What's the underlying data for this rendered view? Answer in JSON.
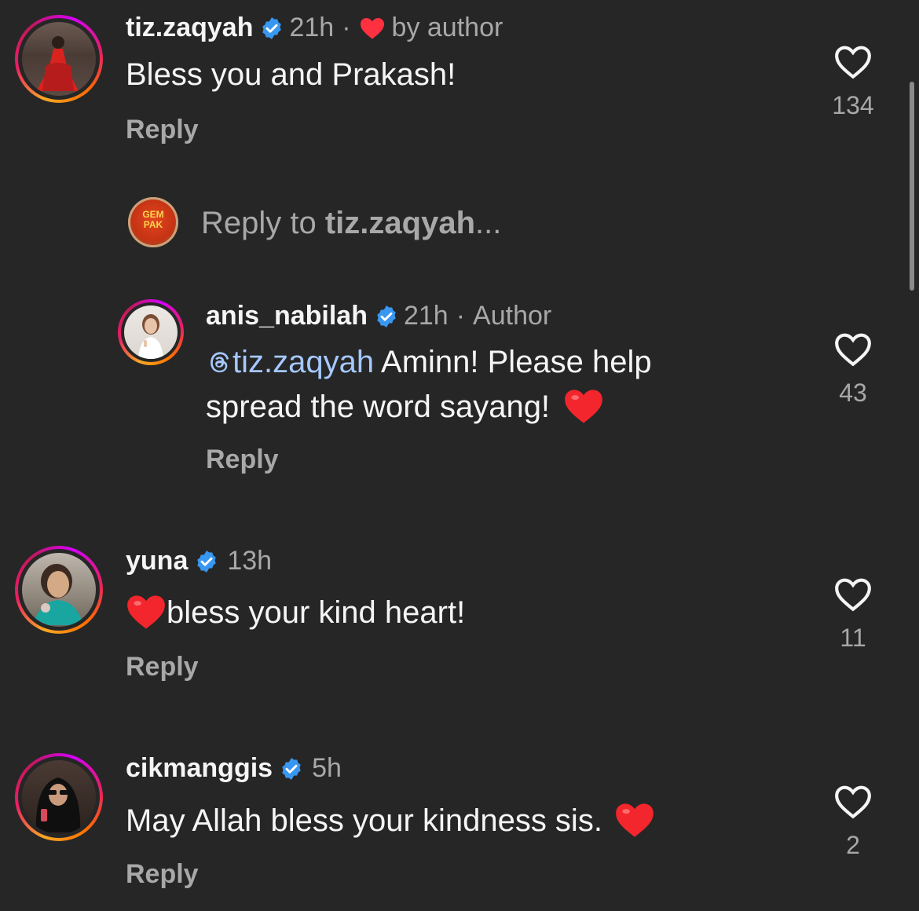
{
  "comments": [
    {
      "username": "tiz.zaqyah",
      "time": "21h",
      "liked_by_author": "by author",
      "text": "Bless you and Prakash!",
      "reply_label": "Reply",
      "likes": "134"
    },
    {
      "username": "yuna",
      "time": "13h",
      "text": "bless your kind heart!",
      "reply_label": "Reply",
      "likes": "11"
    },
    {
      "username": "cikmanggis",
      "time": "5h",
      "text": "May Allah bless your kindness sis.",
      "reply_label": "Reply",
      "likes": "2"
    }
  ],
  "reply_composer": {
    "avatar_text": "GEM PAK",
    "prefix": "Reply to ",
    "target": "tiz.zaqyah",
    "suffix": "..."
  },
  "reply": {
    "username": "anis_nabilah",
    "time": "21h",
    "badge": "Author",
    "mention": "tiz.zaqyah",
    "text_line1": "Aminn! Please help",
    "text_line2": "spread the word sayang!",
    "reply_label": "Reply",
    "likes": "43"
  },
  "colors": {
    "background": "#262626",
    "primary_text": "#f5f5f5",
    "secondary_text": "#a8a8a8",
    "verified": "#3897f0",
    "heart": "#ff3040",
    "mention": "#a5c8ff"
  },
  "icons": {
    "verified": "verified-badge-icon",
    "like": "heart-outline-icon",
    "author_like": "red-heart-icon",
    "emoji": "red-heart-emoji"
  }
}
